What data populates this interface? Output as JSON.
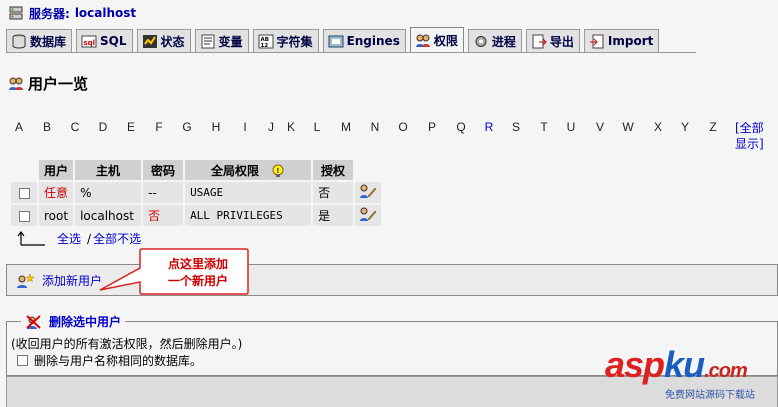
{
  "header": {
    "server_label": "服务器:",
    "server_name": "localhost"
  },
  "tabs": [
    {
      "label": "数据库",
      "icon": "database-icon",
      "active": false
    },
    {
      "label": "SQL",
      "icon": "sql-icon",
      "active": false
    },
    {
      "label": "状态",
      "icon": "status-icon",
      "active": false
    },
    {
      "label": "变量",
      "icon": "variables-icon",
      "active": false
    },
    {
      "label": "字符集",
      "icon": "charset-icon",
      "active": false
    },
    {
      "label": "Engines",
      "icon": "engines-icon",
      "active": false
    },
    {
      "label": "权限",
      "icon": "privileges-icon",
      "active": true
    },
    {
      "label": "进程",
      "icon": "processes-icon",
      "active": false
    },
    {
      "label": "导出",
      "icon": "export-icon",
      "active": false
    },
    {
      "label": "Import",
      "icon": "import-icon",
      "active": false
    }
  ],
  "page": {
    "title": "用户一览"
  },
  "letters": [
    "A",
    "B",
    "C",
    "D",
    "E",
    "F",
    "G",
    "H",
    "I",
    "J",
    "K",
    "L",
    "M",
    "N",
    "O",
    "P",
    "Q",
    "R",
    "S",
    "T",
    "U",
    "V",
    "W",
    "X",
    "Y",
    "Z"
  ],
  "letters_linked": [
    "R"
  ],
  "show_all": "[全部显示]",
  "table": {
    "headers": {
      "user": "用户",
      "host": "主机",
      "password": "密码",
      "global": "全局权限",
      "grant": "授权"
    },
    "rows": [
      {
        "user": "任意",
        "host": "%",
        "password": "--",
        "privileges": "USAGE",
        "grant": "否"
      },
      {
        "user": "root",
        "host": "localhost",
        "password": "否",
        "privileges": "ALL PRIVILEGES",
        "grant": "是"
      }
    ]
  },
  "select_all": "全选",
  "separator": "/",
  "unselect_all": "全部不选",
  "add_user": "添加新用户",
  "callout": {
    "line1": "点这里添加",
    "line2": "一个新用户"
  },
  "delete_section": {
    "legend": "删除选中用户",
    "note": "(收回用户的所有激活权限，然后删除用户。)",
    "option": "删除与用户名称相同的数据库。"
  },
  "watermark": {
    "brand_a": "asp",
    "brand_b": "ku",
    "brand_c": ".com",
    "sub": "免费网站源码下载站"
  },
  "colors": {
    "link": "#0000cc",
    "red": "#cc0000",
    "bg": "#f5f5f5"
  }
}
